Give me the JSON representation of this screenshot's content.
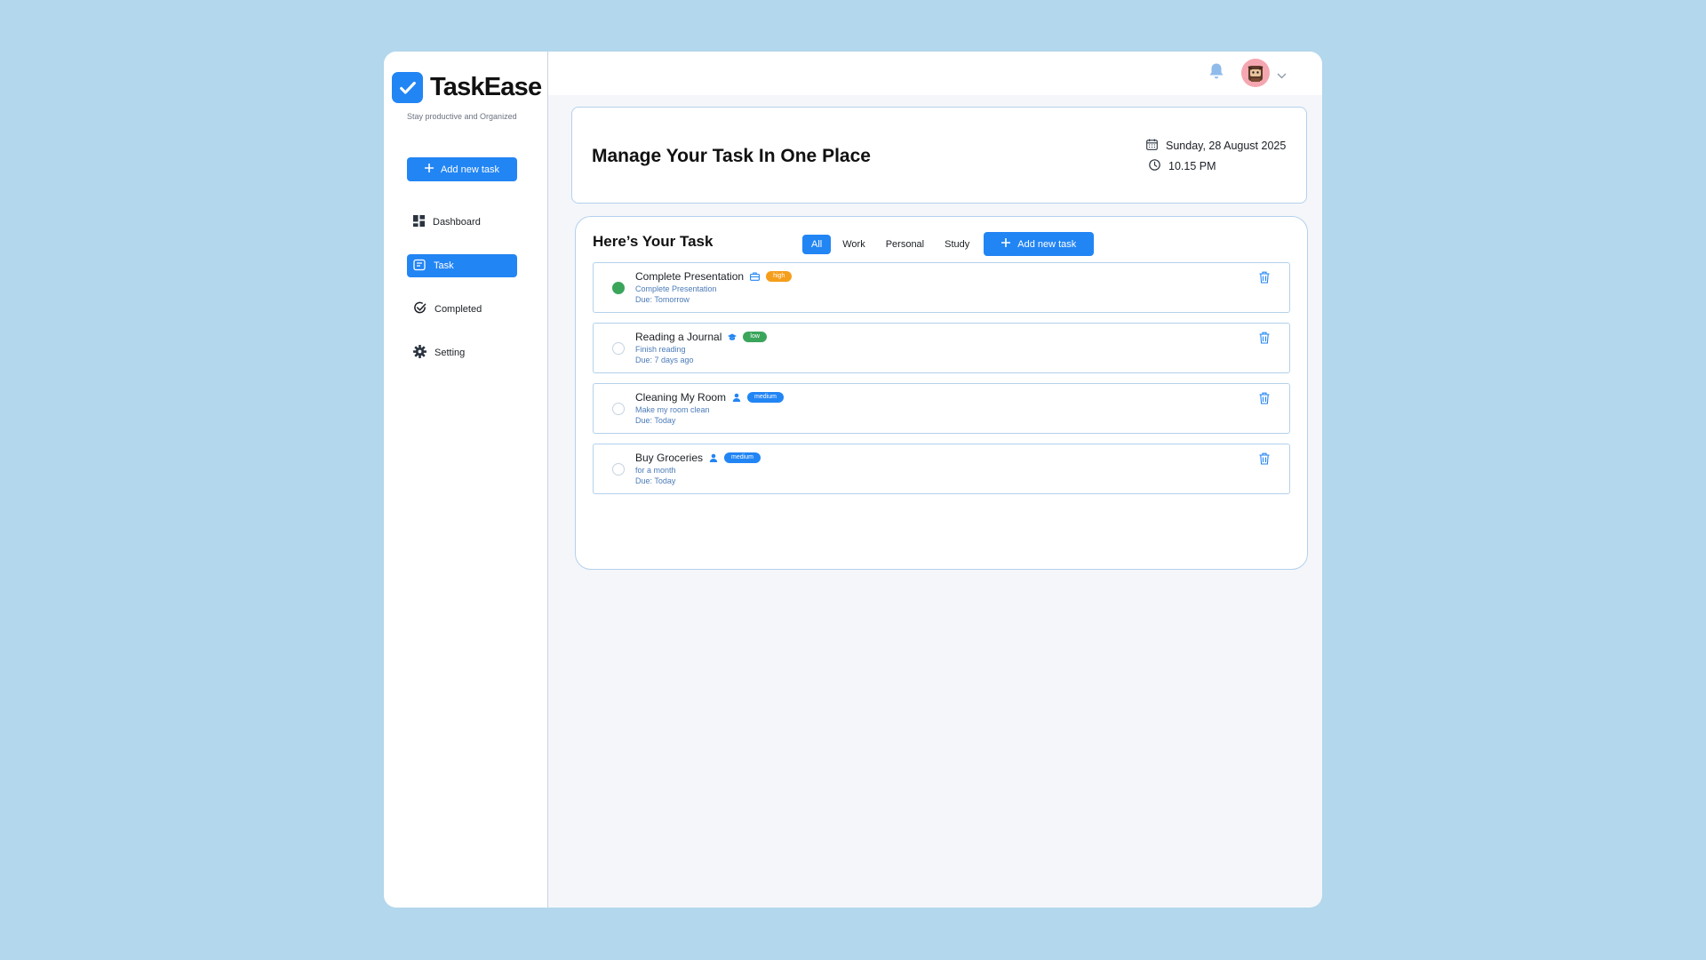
{
  "app": {
    "name": "TaskEase",
    "tagline": "Stay productive and Organized",
    "accent": "#2285f4"
  },
  "sidebar": {
    "add_button": "Add new task",
    "items": [
      {
        "label": "Dashboard",
        "icon": "dashboard-icon",
        "active": false
      },
      {
        "label": "Task",
        "icon": "task-icon",
        "active": true
      },
      {
        "label": "Completed",
        "icon": "check-circle-icon",
        "active": false
      },
      {
        "label": "Setting",
        "icon": "gear-icon",
        "active": false
      }
    ]
  },
  "header": {
    "title": "Manage Your Task In One Place",
    "date": "Sunday, 28 August 2025",
    "time": "10.15 PM"
  },
  "tasks_panel": {
    "heading": "Here’s Your Task",
    "filters": [
      "All",
      "Work",
      "Personal",
      "Study"
    ],
    "active_filter": "All",
    "add_button": "Add new task",
    "tasks": [
      {
        "title": "Complete Presentation",
        "desc": "Complete Presentation",
        "due": "Due: Tomorrow",
        "category_icon": "briefcase-icon",
        "priority": "high",
        "priority_color": "#f59e1c",
        "done": true
      },
      {
        "title": "Reading a Journal",
        "desc": "Finish reading",
        "due": "Due: 7 days ago",
        "category_icon": "graduation-cap-icon",
        "priority": "low",
        "priority_color": "#3ba55c",
        "done": false
      },
      {
        "title": "Cleaning My Room",
        "desc": "Make my room clean",
        "due": "Due: Today",
        "category_icon": "person-icon",
        "priority": "medium",
        "priority_color": "#2285f4",
        "done": false
      },
      {
        "title": "Buy Groceries",
        "desc": "for a month",
        "due": "Due: Today",
        "category_icon": "person-icon",
        "priority": "medium",
        "priority_color": "#2285f4",
        "done": false
      }
    ]
  }
}
